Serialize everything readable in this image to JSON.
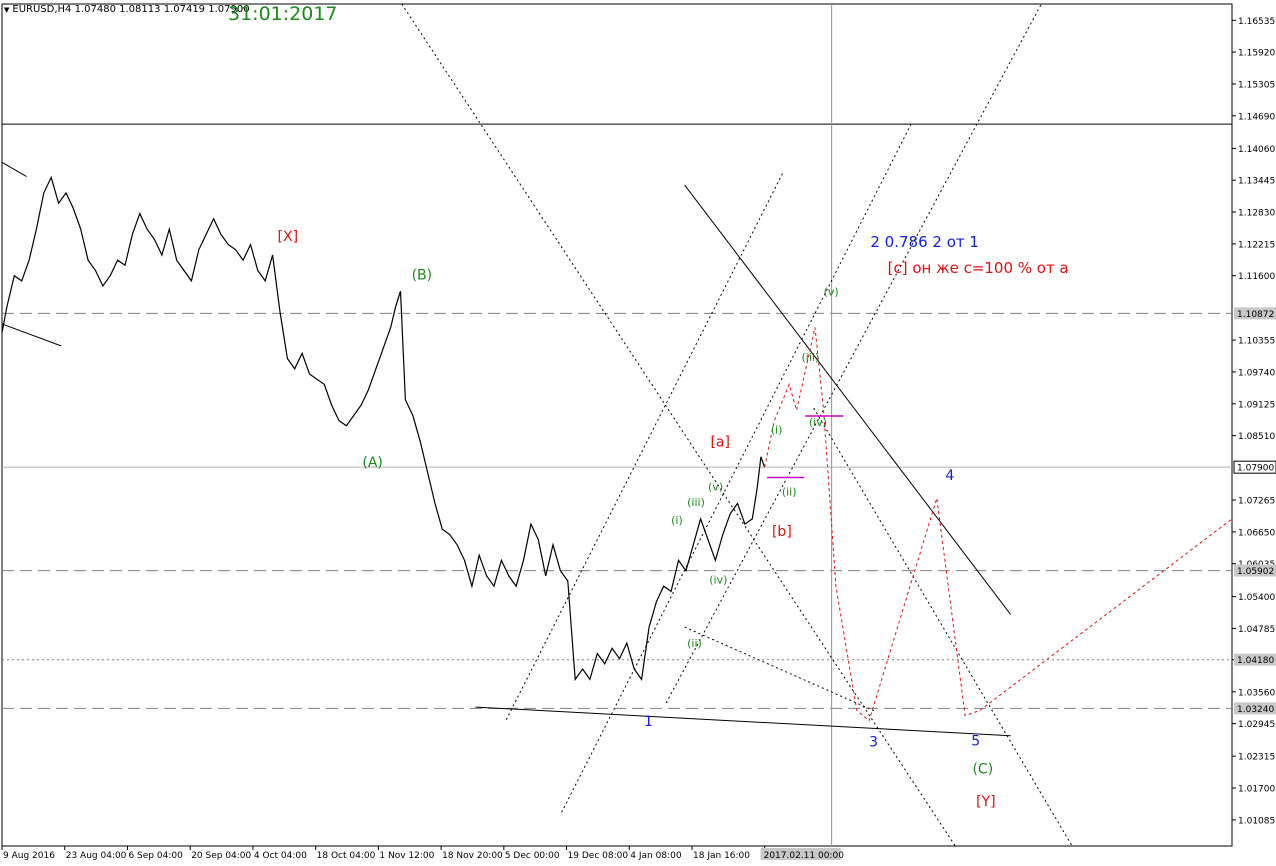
{
  "header": {
    "symbol": "EURUSD,H4",
    "open": "1.07480",
    "high": "1.08113",
    "low": "1.07419",
    "close": "1.07900",
    "date_stamp": "31:01:2017"
  },
  "colors": {
    "background": "#ffffff",
    "price": "#000000",
    "green_label": "#1a8a1a",
    "blue_label": "#1020e0",
    "red_label": "#e01010",
    "forecast": "#e01010",
    "magenta": "#cc00cc",
    "grid_dash": "#808080"
  },
  "chart_data": {
    "type": "line",
    "title": "",
    "ylim": [
      1.0058,
      1.1685
    ],
    "y_ticks": [
      "1.16535",
      "1.15920",
      "1.15305",
      "1.14690",
      "1.14060",
      "1.13445",
      "1.12830",
      "1.12215",
      "1.11600",
      "1.10355",
      "1.09740",
      "1.09125",
      "1.08510",
      "1.07265",
      "1.06650",
      "1.06035",
      "1.05400",
      "1.04785",
      "1.04180",
      "1.03560",
      "1.02945",
      "1.02315",
      "1.01700",
      "1.01085"
    ],
    "y_tick_values": [
      1.16535,
      1.1592,
      1.15305,
      1.1469,
      1.1406,
      1.13445,
      1.1283,
      1.12215,
      1.116,
      1.10355,
      1.0974,
      1.09125,
      1.0851,
      1.07265,
      1.0665,
      1.06035,
      1.054,
      1.04785,
      1.0418,
      1.0356,
      1.02945,
      1.02315,
      1.017,
      1.01085
    ],
    "x_labels": [
      "9 Aug 2016",
      "23 Aug 04:00",
      "6 Sep 04:00",
      "20 Sep 04:00",
      "4 Oct 04:00",
      "18 Oct 04:00",
      "1 Nov 12:00",
      "18 Nov 20:00",
      "5 Dec 00:00",
      "19 Dec 08:00",
      "4 Jan 08:00",
      "18 Jan 16:00",
      "2017.02.11 00:00"
    ],
    "x_label_pos": [
      0,
      0.051,
      0.102,
      0.153,
      0.204,
      0.255,
      0.306,
      0.357,
      0.408,
      0.459,
      0.51,
      0.561,
      0.62
    ],
    "price_levels": [
      {
        "value": 1.10872,
        "label": "1.10872",
        "style": "dash"
      },
      {
        "value": 1.079,
        "label": "1.07900",
        "style": "solid"
      },
      {
        "value": 1.05902,
        "label": "1.05902",
        "style": "dash"
      },
      {
        "value": 1.0418,
        "label": "1.04180",
        "style": "dot"
      },
      {
        "value": 1.0324,
        "label": "1.03240",
        "style": "dash"
      }
    ],
    "horizontal_line": 1.1453,
    "series": [
      {
        "values": [
          [
            0.0,
            1.105
          ],
          [
            0.004,
            1.11
          ],
          [
            0.01,
            1.116
          ],
          [
            0.016,
            1.115
          ],
          [
            0.022,
            1.119
          ],
          [
            0.028,
            1.125
          ],
          [
            0.034,
            1.132
          ],
          [
            0.04,
            1.135
          ],
          [
            0.046,
            1.13
          ],
          [
            0.052,
            1.132
          ],
          [
            0.058,
            1.129
          ],
          [
            0.064,
            1.125
          ],
          [
            0.07,
            1.119
          ],
          [
            0.076,
            1.117
          ],
          [
            0.082,
            1.114
          ],
          [
            0.088,
            1.116
          ],
          [
            0.094,
            1.119
          ],
          [
            0.1,
            1.118
          ],
          [
            0.106,
            1.124
          ],
          [
            0.112,
            1.128
          ],
          [
            0.118,
            1.125
          ],
          [
            0.124,
            1.123
          ],
          [
            0.13,
            1.12
          ],
          [
            0.136,
            1.125
          ],
          [
            0.142,
            1.119
          ],
          [
            0.148,
            1.117
          ],
          [
            0.154,
            1.115
          ],
          [
            0.16,
            1.121
          ],
          [
            0.166,
            1.124
          ],
          [
            0.172,
            1.127
          ],
          [
            0.178,
            1.124
          ],
          [
            0.184,
            1.122
          ],
          [
            0.19,
            1.121
          ],
          [
            0.196,
            1.119
          ],
          [
            0.202,
            1.122
          ],
          [
            0.208,
            1.117
          ],
          [
            0.214,
            1.115
          ],
          [
            0.22,
            1.12
          ],
          [
            0.226,
            1.109
          ],
          [
            0.232,
            1.1
          ],
          [
            0.238,
            1.098
          ],
          [
            0.244,
            1.101
          ],
          [
            0.25,
            1.097
          ],
          [
            0.256,
            1.096
          ],
          [
            0.262,
            1.095
          ],
          [
            0.268,
            1.091
          ],
          [
            0.274,
            1.088
          ],
          [
            0.28,
            1.087
          ],
          [
            0.286,
            1.089
          ],
          [
            0.292,
            1.091
          ],
          [
            0.298,
            1.094
          ],
          [
            0.304,
            1.098
          ],
          [
            0.31,
            1.102
          ],
          [
            0.316,
            1.106
          ],
          [
            0.32,
            1.11
          ],
          [
            0.324,
            1.113
          ],
          [
            0.328,
            1.092
          ],
          [
            0.334,
            1.089
          ],
          [
            0.34,
            1.084
          ],
          [
            0.346,
            1.078
          ],
          [
            0.352,
            1.072
          ],
          [
            0.358,
            1.067
          ],
          [
            0.364,
            1.066
          ],
          [
            0.37,
            1.064
          ],
          [
            0.376,
            1.061
          ],
          [
            0.382,
            1.056
          ],
          [
            0.388,
            1.062
          ],
          [
            0.394,
            1.058
          ],
          [
            0.4,
            1.056
          ],
          [
            0.406,
            1.061
          ],
          [
            0.412,
            1.058
          ],
          [
            0.418,
            1.056
          ],
          [
            0.424,
            1.061
          ],
          [
            0.43,
            1.068
          ],
          [
            0.436,
            1.065
          ],
          [
            0.442,
            1.058
          ],
          [
            0.448,
            1.064
          ],
          [
            0.454,
            1.059
          ],
          [
            0.46,
            1.057
          ],
          [
            0.466,
            1.038
          ],
          [
            0.472,
            1.04
          ],
          [
            0.478,
            1.038
          ],
          [
            0.484,
            1.043
          ],
          [
            0.49,
            1.041
          ],
          [
            0.496,
            1.044
          ],
          [
            0.502,
            1.042
          ],
          [
            0.508,
            1.045
          ],
          [
            0.514,
            1.04
          ],
          [
            0.52,
            1.038
          ],
          [
            0.526,
            1.048
          ],
          [
            0.532,
            1.053
          ],
          [
            0.538,
            1.056
          ],
          [
            0.544,
            1.055
          ],
          [
            0.55,
            1.061
          ],
          [
            0.556,
            1.059
          ],
          [
            0.562,
            1.064
          ],
          [
            0.568,
            1.069
          ],
          [
            0.574,
            1.065
          ],
          [
            0.58,
            1.061
          ],
          [
            0.586,
            1.066
          ],
          [
            0.592,
            1.07
          ],
          [
            0.598,
            1.072
          ],
          [
            0.604,
            1.068
          ],
          [
            0.61,
            1.069
          ],
          [
            0.614,
            1.075
          ],
          [
            0.617,
            1.081
          ],
          [
            0.62,
            1.079
          ]
        ]
      }
    ],
    "vertical_line_x": 0.6745,
    "annotations": [
      {
        "text": "[X]",
        "color": "red",
        "x": 0.224,
        "y": 1.1227
      },
      {
        "text": "(B)",
        "color": "green",
        "x": 0.333,
        "y": 1.1153
      },
      {
        "text": "(A)",
        "color": "green",
        "x": 0.293,
        "y": 1.079
      },
      {
        "text": "1",
        "color": "blue",
        "x": 0.522,
        "y": 1.029
      },
      {
        "text": "3",
        "color": "blue",
        "x": 0.705,
        "y": 1.025
      },
      {
        "text": "4",
        "color": "blue",
        "x": 0.767,
        "y": 1.0765
      },
      {
        "text": "5",
        "color": "blue",
        "x": 0.788,
        "y": 1.0252
      },
      {
        "text": "(C)",
        "color": "green",
        "x": 0.789,
        "y": 1.0198
      },
      {
        "text": "[Y]",
        "color": "red",
        "x": 0.792,
        "y": 1.0135
      },
      {
        "text": "2  0.786 2 от 1",
        "color": "blue",
        "x": 0.706,
        "y": 1.1215
      },
      {
        "text": "[c] он же c=100 % от a",
        "color": "red",
        "x": 0.72,
        "y": 1.1165
      },
      {
        "text": "[a]",
        "color": "red",
        "x": 0.576,
        "y": 1.083
      },
      {
        "text": "[b]",
        "color": "red",
        "x": 0.626,
        "y": 1.0657
      },
      {
        "text": "(i)",
        "color": "green",
        "x": 0.544,
        "y": 1.068
      },
      {
        "text": "(ii)",
        "color": "green",
        "x": 0.557,
        "y": 1.0443
      },
      {
        "text": "(iii)",
        "color": "green",
        "x": 0.557,
        "y": 1.0715
      },
      {
        "text": "(iv)",
        "color": "green",
        "x": 0.575,
        "y": 1.0565
      },
      {
        "text": "(v)",
        "color": "green",
        "x": 0.574,
        "y": 1.0745
      },
      {
        "text": "(i)",
        "color": "green",
        "x": 0.625,
        "y": 1.0855
      },
      {
        "text": "(ii)",
        "color": "green",
        "x": 0.634,
        "y": 1.0735
      },
      {
        "text": "(iii)",
        "color": "green",
        "x": 0.65,
        "y": 1.0995
      },
      {
        "text": "(iv)",
        "color": "green",
        "x": 0.656,
        "y": 1.087
      },
      {
        "text": "(v)",
        "color": "green",
        "x": 0.668,
        "y": 1.1122
      }
    ]
  }
}
